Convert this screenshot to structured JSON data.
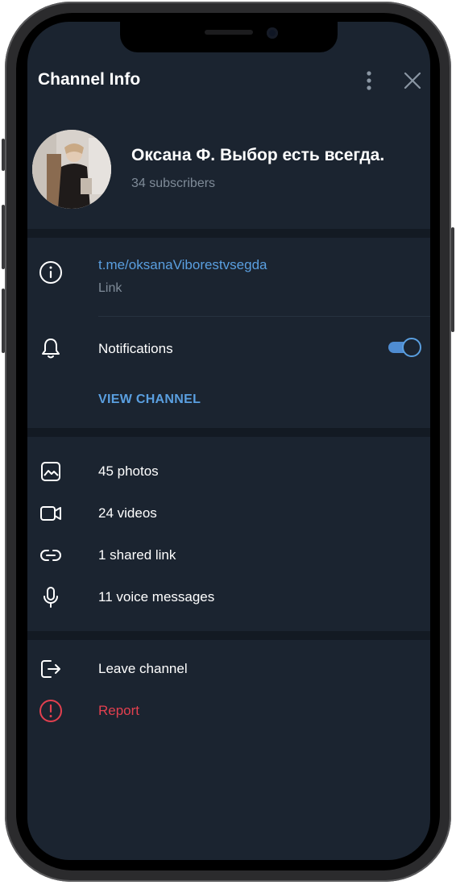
{
  "header": {
    "title": "Channel Info"
  },
  "channel": {
    "name": "Оксана Ф. Выбор есть всегда.",
    "subscribers": "34 subscribers"
  },
  "info": {
    "link": "t.me/oksanaViborestvsegda",
    "link_label": "Link",
    "notifications_label": "Notifications",
    "notifications_on": true,
    "view_channel": "VIEW CHANNEL"
  },
  "media": [
    {
      "icon": "photo-icon",
      "label": "45 photos"
    },
    {
      "icon": "video-icon",
      "label": "24 videos"
    },
    {
      "icon": "link-icon",
      "label": "1 shared link"
    },
    {
      "icon": "microphone-icon",
      "label": "11 voice messages"
    }
  ],
  "actions": [
    {
      "icon": "leave-icon",
      "label": "Leave channel"
    },
    {
      "icon": "report-icon",
      "label": "Report"
    }
  ],
  "colors": {
    "background": "#1b2430",
    "divider": "#131a23",
    "accent": "#5a9fe0",
    "danger": "#e2404f",
    "secondary_text": "#7f8b98"
  }
}
